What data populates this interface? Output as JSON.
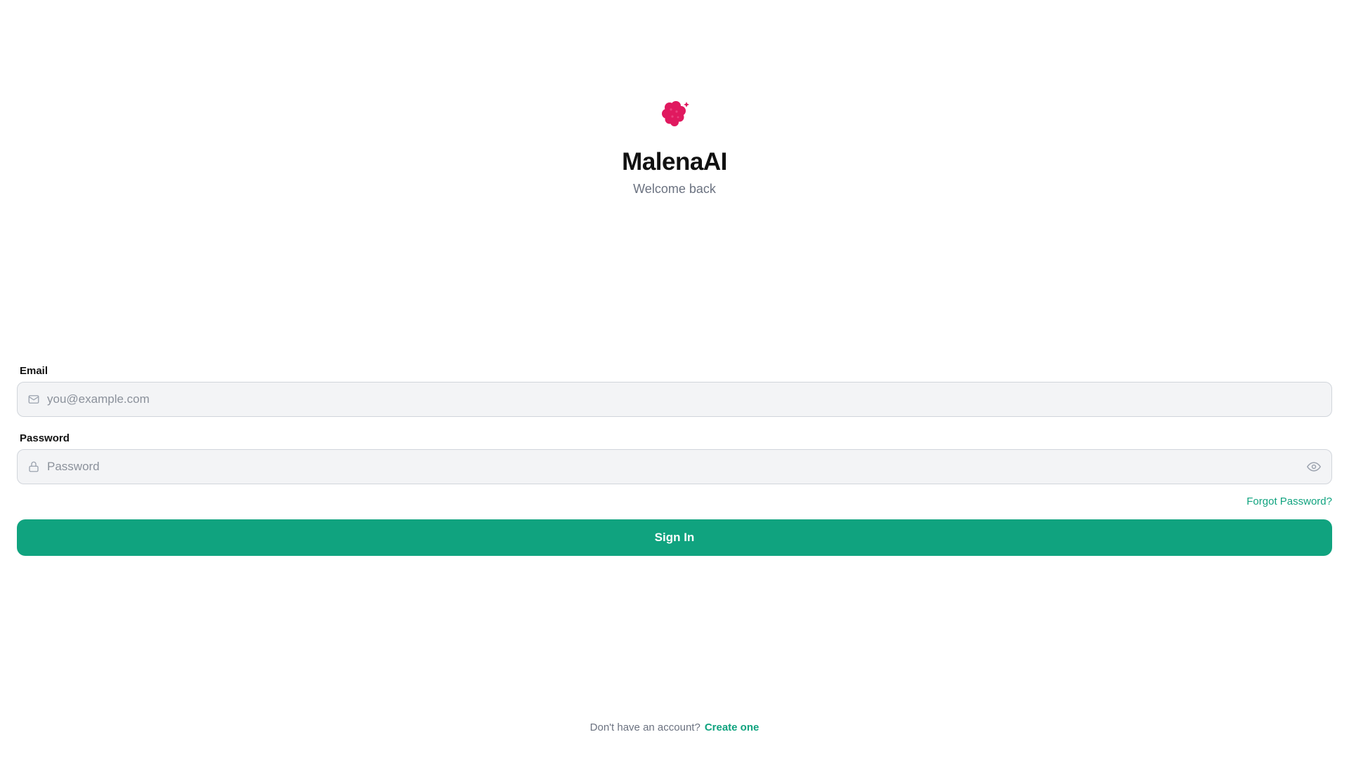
{
  "brand": {
    "name": "MalenaAI",
    "tagline": "Welcome back",
    "logo_icon": "raspberry-icon",
    "logo_color": "#e0195f"
  },
  "form": {
    "email": {
      "label": "Email",
      "placeholder": "you@example.com",
      "value": "",
      "icon": "mail-icon"
    },
    "password": {
      "label": "Password",
      "placeholder": "Password",
      "value": "",
      "icon": "lock-icon",
      "toggle_icon": "eye-icon"
    },
    "forgot_label": "Forgot Password?",
    "submit_label": "Sign In"
  },
  "footer": {
    "prompt": "Don't have an account?",
    "link_label": "Create one"
  },
  "colors": {
    "accent": "#10a37f",
    "input_bg": "#f3f4f6",
    "muted_text": "#6b7280"
  }
}
